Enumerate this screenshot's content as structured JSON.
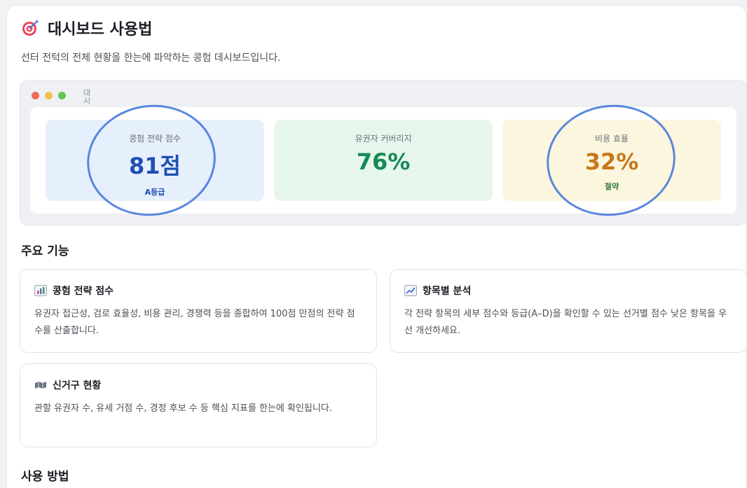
{
  "header": {
    "title": "대시보드 사용법",
    "subtitle": "선터 전턱의 전체 현황을 한는에 파악하는 콩험 데시보드입니다.",
    "title_icon": "target-icon"
  },
  "preview": {
    "window_label": "대시",
    "window_dots": [
      "#ec6a5e",
      "#f4bf4f",
      "#61c554"
    ],
    "metrics": [
      {
        "label": "콩험 전략 점수",
        "value": "81점",
        "sub": "A등급",
        "color": "#1e4fb3"
      },
      {
        "label": "유권자 커버리지",
        "value": "76%",
        "sub": "",
        "color": "#158a56"
      },
      {
        "label": "비용 효율",
        "value": "32%",
        "sub": "절약",
        "color": "#c7781a"
      }
    ]
  },
  "features_section": {
    "title": "주요 기능",
    "items": [
      {
        "icon": "bar-chart-icon",
        "title": "콩험 전략 점수",
        "body": "유권자 접근성, 검로 효율성, 비용 관리, 경쟁력 등을 종합하여 100점 만점의 전략 점수를 산출합니다."
      },
      {
        "icon": "line-chart-icon",
        "title": "항목별 분석",
        "body": "각 전략 항목의 세부 점수와 등급(A–D)을 확인할 수 있는 선거별 점수 낮은 항목을 우선 개선하세요."
      },
      {
        "icon": "map-icon",
        "title": "신거구 현황",
        "body": "관할 유권자 수, 유세 거점 수, 경정 후보 수 등 핵심 지표를 한는에 확인됩니다."
      }
    ]
  },
  "usage_section": {
    "title": "사용 방법"
  }
}
